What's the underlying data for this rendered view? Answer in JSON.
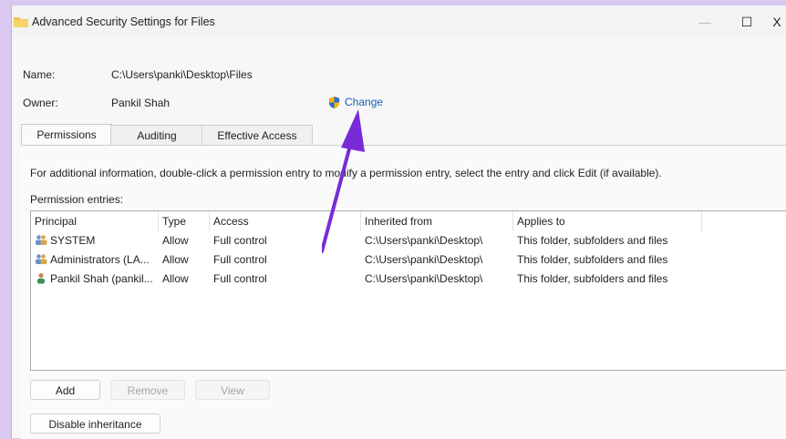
{
  "window": {
    "title": "Advanced Security Settings for Files",
    "controls": {
      "minimize": "—",
      "maximize": "☐",
      "close": "X"
    }
  },
  "owner_section": {
    "name_label": "Name:",
    "name_value": "C:\\Users\\panki\\Desktop\\Files",
    "owner_label": "Owner:",
    "owner_value": "Pankil Shah",
    "change_link": "Change"
  },
  "tabs": [
    {
      "label": "Permissions",
      "active": true
    },
    {
      "label": "Auditing",
      "active": false
    },
    {
      "label": "Effective Access",
      "active": false
    }
  ],
  "info_text": "For additional information, double-click a permission entry to modify a permission entry, select the entry and click Edit (if available).",
  "entries_label": "Permission entries:",
  "columns": [
    "Principal",
    "Type",
    "Access",
    "Inherited from",
    "Applies to"
  ],
  "entries": [
    {
      "icon": "group-icon",
      "principal": "SYSTEM",
      "type": "Allow",
      "access": "Full control",
      "inherited_from": "C:\\Users\\panki\\Desktop\\",
      "applies_to": "This folder, subfolders and files"
    },
    {
      "icon": "group-icon",
      "principal": "Administrators (LA...",
      "type": "Allow",
      "access": "Full control",
      "inherited_from": "C:\\Users\\panki\\Desktop\\",
      "applies_to": "This folder, subfolders and files"
    },
    {
      "icon": "user-icon",
      "principal": "Pankil Shah (pankil...",
      "type": "Allow",
      "access": "Full control",
      "inherited_from": "C:\\Users\\panki\\Desktop\\",
      "applies_to": "This folder, subfolders and files"
    }
  ],
  "buttons": {
    "add": "Add",
    "remove": "Remove",
    "view": "View",
    "disable_inheritance": "Disable inheritance"
  },
  "colors": {
    "annotation_arrow": "#7a2bd8",
    "link": "#1a5fb4",
    "background_border": "#d9c8ef"
  }
}
